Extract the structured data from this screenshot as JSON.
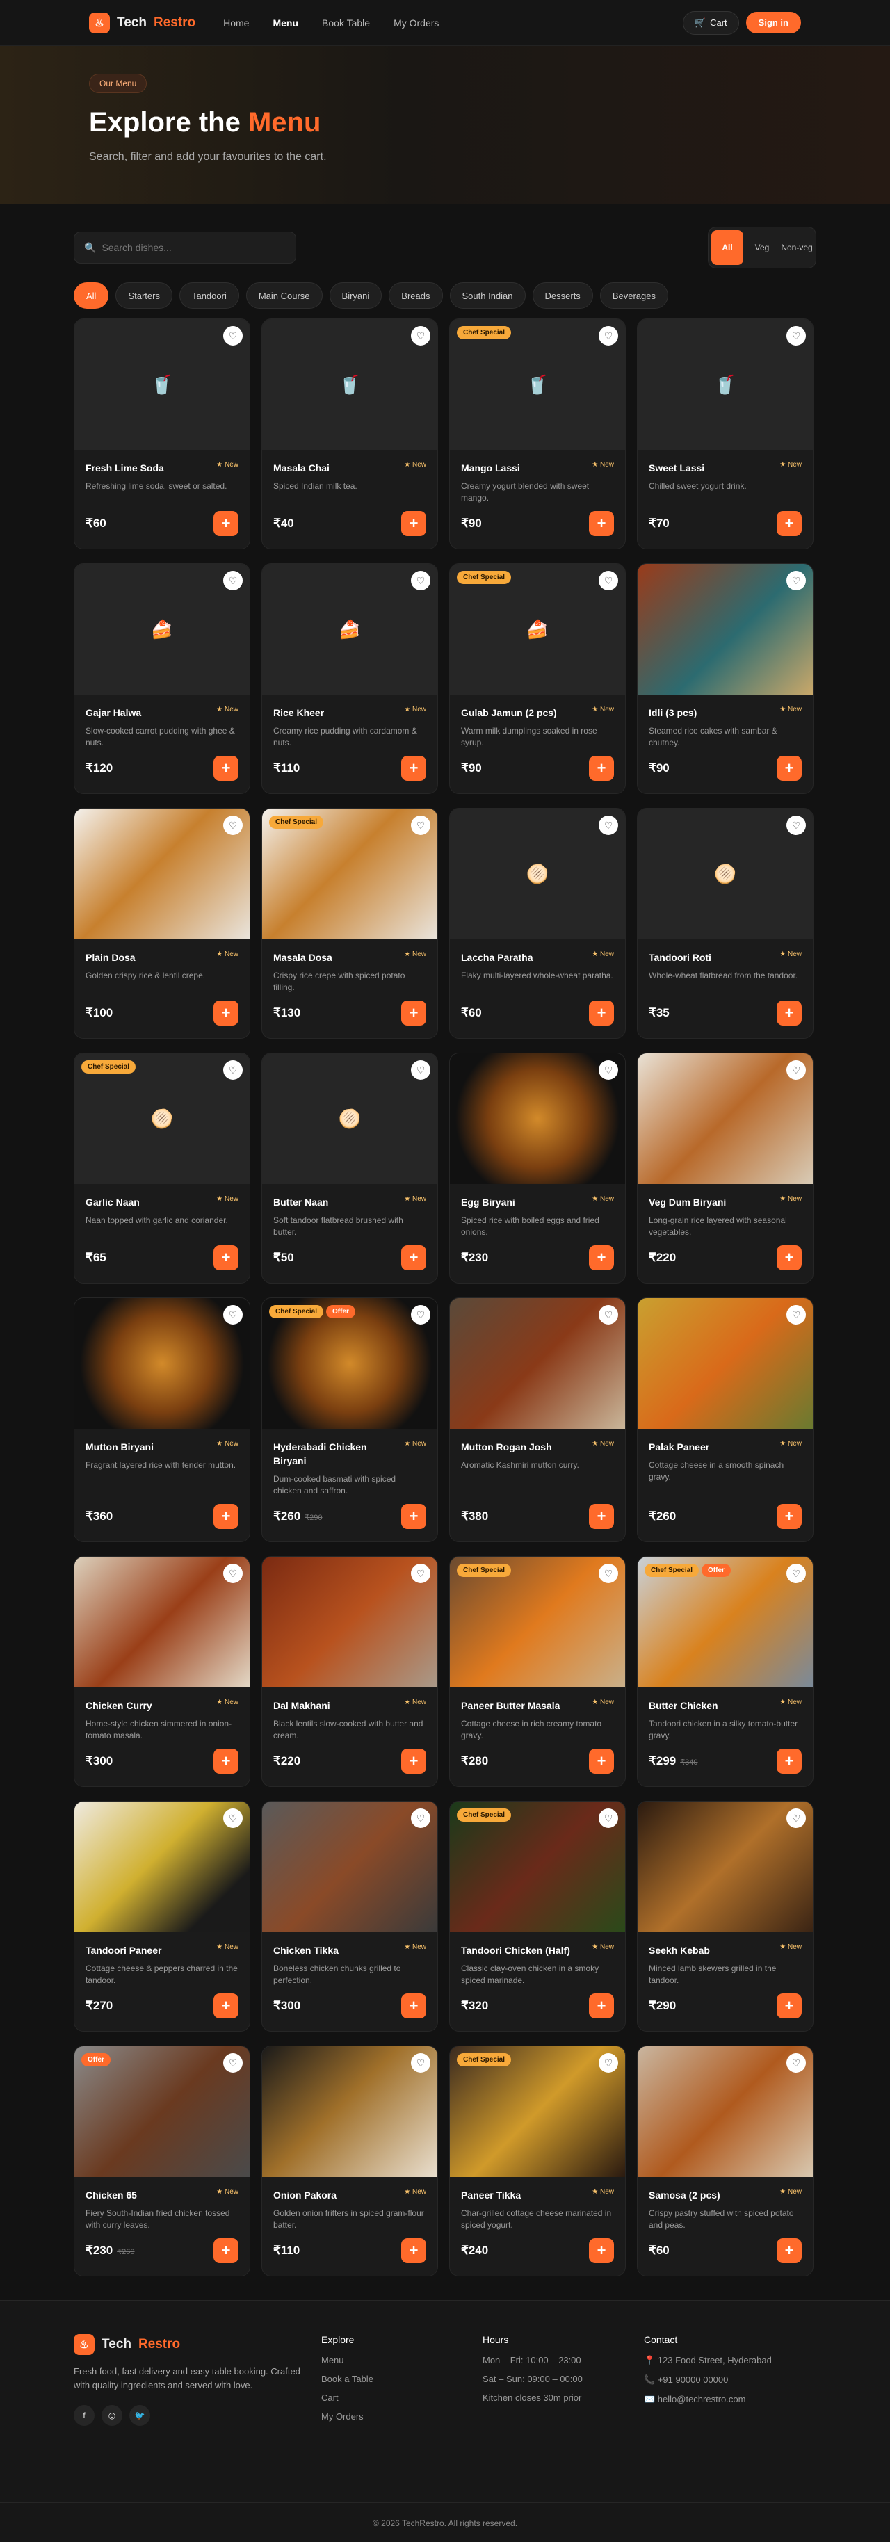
{
  "nav": {
    "brand_a": "Tech",
    "brand_b": "Restro",
    "links": [
      "Home",
      "Menu",
      "Book Table",
      "My Orders"
    ],
    "cart": "Cart",
    "signin": "Sign in"
  },
  "hero": {
    "pill": "Our Menu",
    "title_a": "Explore the",
    "title_b": "Menu",
    "subtitle": "Search, filter and add your favourites to the cart."
  },
  "filters": {
    "search_placeholder": "Search dishes...",
    "diet": [
      "All",
      "Veg",
      "Non-veg"
    ],
    "categories": [
      "All",
      "Starters",
      "Tandoori",
      "Main Course",
      "Biryani",
      "Breads",
      "South Indian",
      "Desserts",
      "Beverages"
    ]
  },
  "badge_new": "★ New",
  "badge_chef": "Chef Special",
  "badge_offer": "Offer",
  "dishes": [
    {
      "name": "Fresh Lime Soda",
      "desc": "Refreshing lime soda, sweet or salted.",
      "price": "₹60",
      "icon": "🥤",
      "bg": "#262626"
    },
    {
      "name": "Masala Chai",
      "desc": "Spiced Indian milk tea.",
      "price": "₹40",
      "icon": "🥤",
      "bg": "#262626"
    },
    {
      "name": "Mango Lassi",
      "desc": "Creamy yogurt blended with sweet mango.",
      "price": "₹90",
      "icon": "🥤",
      "bg": "#262626",
      "chef": true
    },
    {
      "name": "Sweet Lassi",
      "desc": "Chilled sweet yogurt drink.",
      "price": "₹70",
      "icon": "🥤",
      "bg": "#262626"
    },
    {
      "name": "Gajar Halwa",
      "desc": "Slow-cooked carrot pudding with ghee & nuts.",
      "price": "₹120",
      "icon": "🍰",
      "bg": "#262626"
    },
    {
      "name": "Rice Kheer",
      "desc": "Creamy rice pudding with cardamom & nuts.",
      "price": "₹110",
      "icon": "🍰",
      "bg": "#262626"
    },
    {
      "name": "Gulab Jamun (2 pcs)",
      "desc": "Warm milk dumplings soaked in rose syrup.",
      "price": "₹90",
      "icon": "🍰",
      "bg": "#262626",
      "chef": true
    },
    {
      "name": "Idli (3 pcs)",
      "desc": "Steamed rice cakes with sambar & chutney.",
      "price": "₹90",
      "icon": "",
      "bg": "linear-gradient(135deg,#9a3b1a,#2c6b70 55%,#c9a86a)"
    },
    {
      "name": "Plain Dosa",
      "desc": "Golden crispy rice & lentil crepe.",
      "price": "₹100",
      "icon": "",
      "bg": "linear-gradient(135deg,#f4f1ec,#c7802e 45%,#e9e4dc)"
    },
    {
      "name": "Masala Dosa",
      "desc": "Crispy rice crepe with spiced potato filling.",
      "price": "₹130",
      "icon": "",
      "bg": "linear-gradient(135deg,#f4f1ec,#c7802e 45%,#e9e4dc)",
      "chef": true
    },
    {
      "name": "Laccha Paratha",
      "desc": "Flaky multi-layered whole-wheat paratha.",
      "price": "₹60",
      "icon": "🫓",
      "bg": "#262626"
    },
    {
      "name": "Tandoori Roti",
      "desc": "Whole-wheat flatbread from the tandoor.",
      "price": "₹35",
      "icon": "🫓",
      "bg": "#262626"
    },
    {
      "name": "Garlic Naan",
      "desc": "Naan topped with garlic and coriander.",
      "price": "₹65",
      "icon": "🫓",
      "bg": "#262626",
      "chef": true
    },
    {
      "name": "Butter Naan",
      "desc": "Soft tandoor flatbread brushed with butter.",
      "price": "₹50",
      "icon": "🫓",
      "bg": "#262626"
    },
    {
      "name": "Egg Biryani",
      "desc": "Spiced rice with boiled eggs and fried onions.",
      "price": "₹230",
      "icon": "",
      "bg": "radial-gradient(circle,#d28a2a 0%,#7a3f10 45%,#111 75%)"
    },
    {
      "name": "Veg Dum Biryani",
      "desc": "Long-grain rice layered with seasonal vegetables.",
      "price": "₹220",
      "icon": "",
      "bg": "linear-gradient(135deg,#e9e2d6,#b8692a 50%,#d8cbb6)"
    },
    {
      "name": "Mutton Biryani",
      "desc": "Fragrant layered rice with tender mutton.",
      "price": "₹360",
      "icon": "",
      "bg": "radial-gradient(circle,#d28a2a 0%,#7a3f10 45%,#111 75%)",
      "big": true
    },
    {
      "name": "Hyderabadi Chicken Biryani",
      "desc": "Dum-cooked basmati with spiced chicken and saffron.",
      "price": "₹260",
      "old": "₹290",
      "icon": "",
      "bg": "radial-gradient(circle,#d28a2a 0%,#7a3f10 45%,#111 75%)",
      "chef": true,
      "offer": true,
      "big": true
    },
    {
      "name": "Mutton Rogan Josh",
      "desc": "Aromatic Kashmiri mutton curry.",
      "price": "₹380",
      "icon": "",
      "bg": "linear-gradient(135deg,#5a4a3a,#8a3a18 50%,#c9b69a)",
      "big": true
    },
    {
      "name": "Palak Paneer",
      "desc": "Cottage cheese in a smooth spinach gravy.",
      "price": "₹260",
      "icon": "",
      "bg": "linear-gradient(135deg,#c9a030,#d96a1a 50%,#6a7a30)",
      "big": true
    },
    {
      "name": "Chicken Curry",
      "desc": "Home-style chicken simmered in onion-tomato masala.",
      "price": "₹300",
      "icon": "",
      "bg": "linear-gradient(135deg,#dcd0bc,#9a3f18 50%,#e3d8c6)"
    },
    {
      "name": "Dal Makhani",
      "desc": "Black lentils slow-cooked with butter and cream.",
      "price": "₹220",
      "icon": "",
      "bg": "linear-gradient(135deg,#7a2a12,#b8521e 50%,#a99a8a)"
    },
    {
      "name": "Paneer Butter Masala",
      "desc": "Cottage cheese in rich creamy tomato gravy.",
      "price": "₹280",
      "icon": "",
      "bg": "linear-gradient(135deg,#6a4a30,#e07a1e 50%,#c9b08a)",
      "chef": true
    },
    {
      "name": "Butter Chicken",
      "desc": "Tandoori chicken in a silky tomato-butter gravy.",
      "price": "₹299",
      "old": "₹340",
      "icon": "",
      "bg": "linear-gradient(135deg,#c9d1d8,#d9821e 50%,#7a8a9a)",
      "chef": true,
      "offer": true
    },
    {
      "name": "Tandoori Paneer",
      "desc": "Cottage cheese & peppers charred in the tandoor.",
      "price": "₹270",
      "icon": "",
      "bg": "linear-gradient(135deg,#efeae0,#d0b030 45%,#1a1a1a 80%)"
    },
    {
      "name": "Chicken Tikka",
      "desc": "Boneless chicken chunks grilled to perfection.",
      "price": "₹300",
      "icon": "",
      "bg": "linear-gradient(135deg,#5a5a5a,#8a4a28 50%,#3a3a3a)"
    },
    {
      "name": "Tandoori Chicken (Half)",
      "desc": "Classic clay-oven chicken in a smoky spiced marinade.",
      "price": "₹320",
      "icon": "",
      "bg": "linear-gradient(135deg,#1a3a1a,#6a2a1a 50%,#2a4a1a)",
      "chef": true
    },
    {
      "name": "Seekh Kebab",
      "desc": "Minced lamb skewers grilled in the tandoor.",
      "price": "₹290",
      "icon": "",
      "bg": "linear-gradient(135deg,#2a1a10,#b0702a 50%,#3a2414)"
    },
    {
      "name": "Chicken 65",
      "desc": "Fiery South-Indian fried chicken tossed with curry leaves.",
      "price": "₹230",
      "old": "₹260",
      "icon": "",
      "bg": "linear-gradient(135deg,#8a8a8a,#6a3a20 50%,#4a4a4a)",
      "offer": true
    },
    {
      "name": "Onion Pakora",
      "desc": "Golden onion fritters in spiced gram-flour batter.",
      "price": "₹110",
      "icon": "",
      "bg": "linear-gradient(135deg,#1a1a1a,#a0702a 45%,#e9dfcf)"
    },
    {
      "name": "Paneer Tikka",
      "desc": "Char-grilled cottage cheese marinated in spiced yogurt.",
      "price": "₹240",
      "icon": "",
      "bg": "linear-gradient(135deg,#3a2a20,#d09a2a 50%,#2a1a10)",
      "chef": true
    },
    {
      "name": "Samosa (2 pcs)",
      "desc": "Crispy pastry stuffed with spiced potato and peas.",
      "price": "₹60",
      "icon": "",
      "bg": "linear-gradient(135deg,#c9b6a0,#b05a1e 50%,#d8c8b0)"
    }
  ],
  "footer": {
    "brand_a": "Tech",
    "brand_b": "Restro",
    "desc": "Fresh food, fast delivery and easy table booking. Crafted with quality ingredients and served with love.",
    "socials": [
      "f",
      "◎",
      "🐦"
    ],
    "explore_title": "Explore",
    "explore": [
      "Menu",
      "Book a Table",
      "Cart",
      "My Orders"
    ],
    "hours_title": "Hours",
    "hours": [
      "Mon – Fri: 10:00 – 23:00",
      "Sat – Sun: 09:00 – 00:00",
      "Kitchen closes 30m prior"
    ],
    "contact_title": "Contact",
    "contact": [
      "📍 123 Food Street, Hyderabad",
      "📞 +91 90000 00000",
      "✉️ hello@techrestro.com"
    ],
    "copyright": "© 2026 TechRestro. All rights reserved."
  }
}
